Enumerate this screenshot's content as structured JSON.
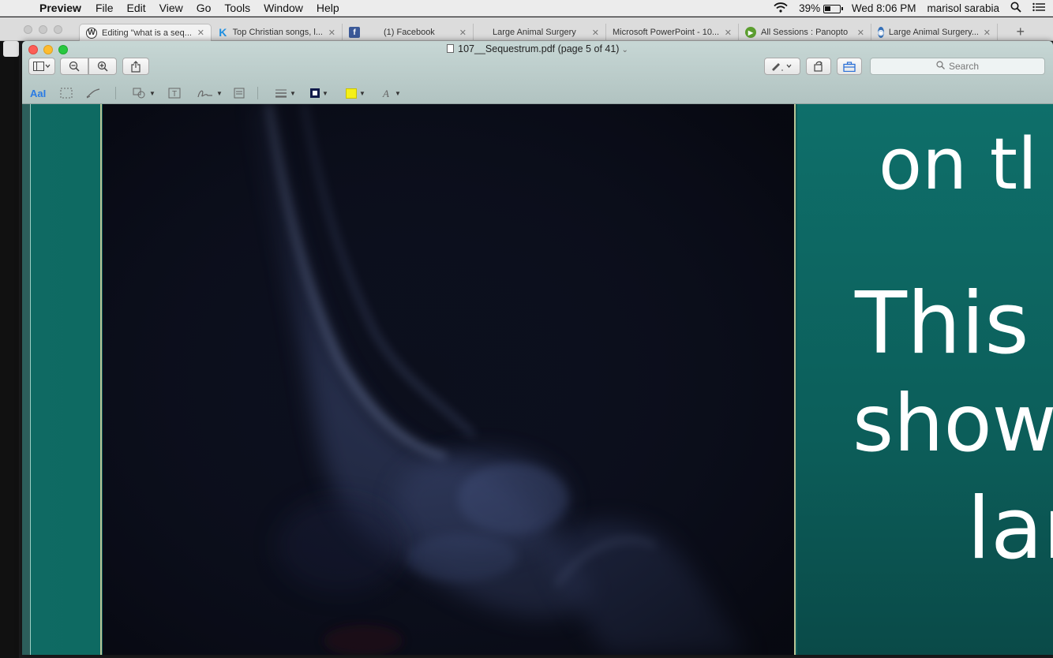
{
  "menubar": {
    "app_name": "Preview",
    "menus": [
      "File",
      "Edit",
      "View",
      "Go",
      "Tools",
      "Window",
      "Help"
    ],
    "battery": "39%",
    "clock": "Wed 8:06 PM",
    "user": "marisol sarabia"
  },
  "browser": {
    "tabs": [
      {
        "label": "Editing \"what is a seq...",
        "icon": "wordpress-icon"
      },
      {
        "label": "Top Christian songs, l...",
        "icon": "k-icon"
      },
      {
        "label": "(1) Facebook",
        "icon": "facebook-icon"
      },
      {
        "label": "Large Animal Surgery",
        "icon": ""
      },
      {
        "label": "Microsoft PowerPoint - 10...",
        "icon": ""
      },
      {
        "label": "All Sessions : Panopto",
        "icon": "panopto-icon"
      },
      {
        "label": "Large Animal Surgery...",
        "icon": "globe-icon"
      }
    ],
    "new_tab": "+"
  },
  "preview": {
    "document_title": "107__Sequestrum.pdf (page 5 of 41)",
    "search_placeholder": "Search",
    "markup_text_tool": "AaI"
  },
  "slide": {
    "line1": "on tl",
    "line2": "This",
    "line3": "show",
    "line4": "lar"
  },
  "colors": {
    "teal": "#0e6a63",
    "xray_bg": "#0b0d17",
    "highlight_swatch": "#f5f019",
    "border_swatch": "#111a4a"
  }
}
